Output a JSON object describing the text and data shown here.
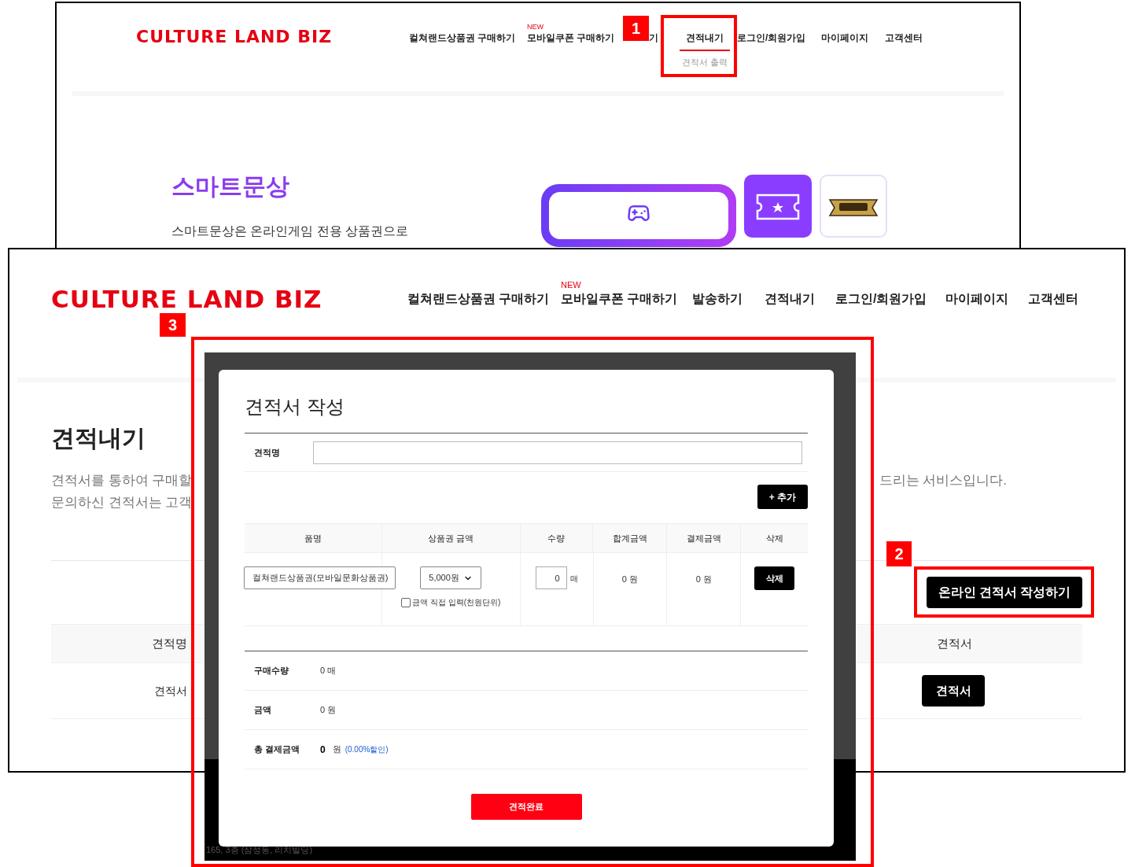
{
  "top_screenshot": {
    "logo": "CULTURE LAND BIZ",
    "nav": [
      {
        "label": "컬쳐랜드상품권 구매하기",
        "selected": false
      },
      {
        "label": "모바일쿠폰 구매하기",
        "badge": "NEW",
        "selected": false
      },
      {
        "label": "기",
        "selected": false
      },
      {
        "label": "견적내기",
        "selected": true,
        "submenu": [
          "견적서 출력"
        ]
      },
      {
        "label": "로그인/회원가입",
        "selected": false
      },
      {
        "label": "마이페이지",
        "selected": false
      },
      {
        "label": "고객센터",
        "selected": false
      }
    ],
    "heading": "스마트문상",
    "description": "스마트문상은 온라인게임 전용 상품권으로"
  },
  "main_screenshot": {
    "logo": "CULTURE LAND BIZ",
    "nav": [
      {
        "label": "컬쳐랜드상품권 구매하기",
        "selected": false
      },
      {
        "label": "모바일쿠폰 구매하기",
        "badge": "NEW",
        "selected": false
      },
      {
        "label": "발송하기",
        "selected": false
      },
      {
        "label": "견적내기",
        "selected": false
      },
      {
        "label": "로그인/회원가입",
        "selected": false
      },
      {
        "label": "마이페이지",
        "selected": false
      },
      {
        "label": "고객센터",
        "selected": false
      }
    ],
    "heading": "견적내기",
    "description_lines": [
      {
        "left": "견적서를 통하여 구매할",
        "right": "드리는 서비스입니다."
      },
      {
        "left": "문의하신 견적서는 고객"
      }
    ],
    "create_button": "온라인 견적서 작성하기",
    "table": {
      "columns": [
        "견적명",
        "견적서"
      ],
      "rows": [
        {
          "name": "견적서",
          "action": "견적서"
        }
      ]
    },
    "footer_lines": [
      "165, 3층 (삼성동, 리치빌딩)"
    ]
  },
  "modal": {
    "title": "견적서 작성",
    "name_label": "견적명",
    "add_button": "+ 추가",
    "columns": [
      "품명",
      "상품권 금액",
      "수량",
      "합계금액",
      "결제금액",
      "삭제"
    ],
    "rows": [
      {
        "product": "컬쳐랜드상품권(모바일문화상품권)",
        "amount": "5,000원",
        "direct_input": {
          "label": "금액 직접 입력(천원단위)",
          "checked": false
        },
        "quantity": "0",
        "unit": "매",
        "total": "0 원",
        "payment": "0 원",
        "delete_button": "삭제"
      }
    ],
    "summary": [
      {
        "label": "구매수량",
        "value": "0 매"
      },
      {
        "label": "금액",
        "value": "0 원"
      },
      {
        "label": "총 결제금액",
        "value": "0",
        "unit": "원",
        "discount": "(0.00%할인)"
      }
    ],
    "submit_button": "견적완료"
  },
  "callouts": [
    "1",
    "2",
    "3"
  ]
}
